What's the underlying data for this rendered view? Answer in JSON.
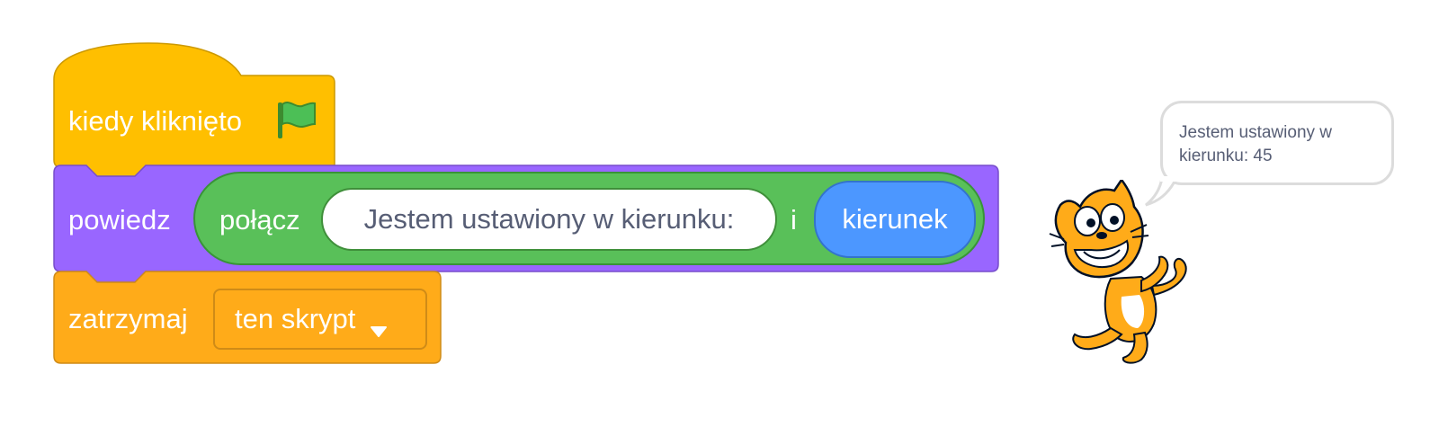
{
  "script": {
    "hat_block": {
      "label": "kiedy kliknięto",
      "icon": "green-flag-icon",
      "color": "#ffbf00"
    },
    "say_block": {
      "label": "powiedz",
      "color": "#9966ff",
      "join_block": {
        "label": "połącz",
        "color": "#59c059",
        "first_input": "Jestem ustawiony w kierunku:",
        "connector": "i",
        "direction_reporter": {
          "label": "kierunek",
          "color": "#4c97ff"
        }
      }
    },
    "stop_block": {
      "label": "zatrzymaj",
      "color": "#ffab19",
      "dropdown_value": "ten skrypt"
    }
  },
  "stage": {
    "speech_bubble": {
      "text": "Jestem ustawiony w kierunku: 45"
    },
    "sprite": "scratch-cat-icon"
  }
}
